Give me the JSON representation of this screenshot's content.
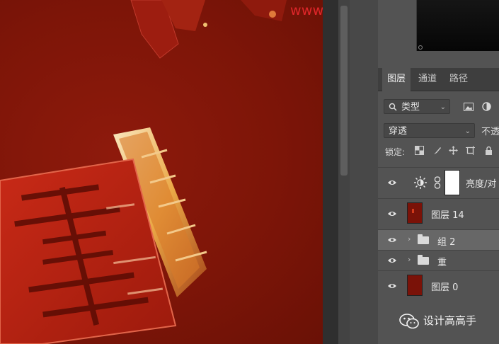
{
  "watermark": "www.haoyundiansheji.com",
  "layers_panel": {
    "tabs": [
      {
        "label": "图层",
        "active": true
      },
      {
        "label": "通道",
        "active": false
      },
      {
        "label": "路径",
        "active": false
      }
    ],
    "filter_label": "类型",
    "blend_mode": "穿透",
    "opacity_label": "不透",
    "lock_label": "锁定:",
    "layers": [
      {
        "name": "亮度/对",
        "kind": "adjustment",
        "visible": true,
        "selected": false
      },
      {
        "name": "图层 14",
        "kind": "pixel",
        "visible": true,
        "selected": false
      },
      {
        "name": "组 2",
        "kind": "group",
        "visible": true,
        "selected": true
      },
      {
        "name": "重",
        "kind": "group",
        "visible": true,
        "selected": false
      },
      {
        "name": "图层 0",
        "kind": "pixel",
        "visible": true,
        "selected": false
      }
    ]
  },
  "footer_watermark": "设计高高手",
  "colors": {
    "canvas_red": "#7d1508",
    "watermark_red": "#e0262a",
    "panel_bg": "#535353",
    "selected_row": "#676767"
  }
}
